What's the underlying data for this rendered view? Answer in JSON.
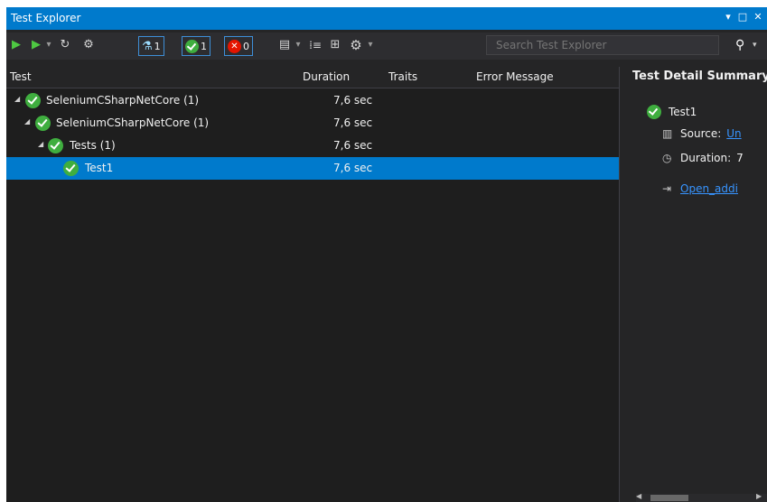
{
  "window": {
    "title": "Test Explorer",
    "pin_icon": "▾",
    "maximize_icon": "□",
    "close_icon": "✕"
  },
  "toolbar": {
    "run_all_icon": "▶",
    "run_icon": "▶",
    "dropdown_glyph": "▾",
    "rerun_icon": "↻",
    "settings_run_icon": "⚙",
    "filter_total_count": "1",
    "filter_passed_count": "1",
    "filter_failed_count": "0",
    "failed_glyph": "✕",
    "playlist_icon": "▤",
    "group_icon": "⁞≡",
    "columns_icon": "⊞",
    "settings_icon": "⚙",
    "search_placeholder": "Search Test Explorer",
    "search_icon": "⚲"
  },
  "grid": {
    "columns": [
      "Test",
      "Duration",
      "Traits",
      "Error Message"
    ],
    "rows": [
      {
        "name": "SeleniumCSharpNetCore (1)",
        "duration": "7,6 sec"
      },
      {
        "name": "SeleniumCSharpNetCore (1)",
        "duration": "7,6 sec"
      },
      {
        "name": "Tests (1)",
        "duration": "7,6 sec"
      },
      {
        "name": "Test1",
        "duration": "7,6 sec"
      }
    ],
    "expand_glyph": "◢"
  },
  "detail": {
    "title": "Test Detail Summary",
    "test_name": "Test1",
    "source_label": "Source:",
    "source_value": "Un",
    "duration_label": "Duration:",
    "duration_value": "7",
    "open_link": "Open_addi",
    "source_icon": "▥",
    "duration_icon": "◷",
    "open_icon": "⇥"
  },
  "colors": {
    "accent": "#007acc",
    "background": "#1e1e1e",
    "panel": "#252526",
    "passed": "#3fae3f",
    "failed": "#e51400",
    "link": "#3794ff"
  }
}
